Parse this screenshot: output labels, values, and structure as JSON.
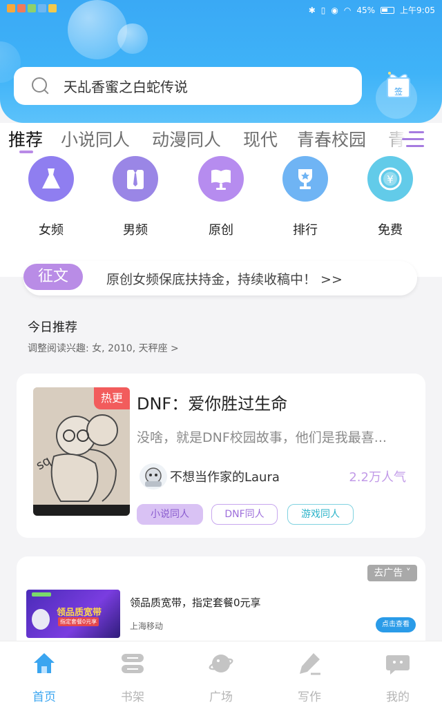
{
  "status_bar": {
    "battery": "45%",
    "time": "上午9:05"
  },
  "search": {
    "query": "天乩香蜜之白蛇传说"
  },
  "signin": {
    "label": "签"
  },
  "tabs": [
    "推荐",
    "小说同人",
    "动漫同人",
    "现代",
    "青春校园",
    "青春"
  ],
  "active_tab": 0,
  "quick_entries": [
    {
      "label": "女频",
      "icon": "dress-icon",
      "color": "#8f7ef0"
    },
    {
      "label": "男频",
      "icon": "shirt-icon",
      "color": "#9a86e6"
    },
    {
      "label": "原创",
      "icon": "book-stand-icon",
      "color": "#b68cef"
    },
    {
      "label": "排行",
      "icon": "trophy-icon",
      "color": "#6fb4f4"
    },
    {
      "label": "免费",
      "icon": "coin-icon",
      "color": "#62cbe9"
    }
  ],
  "notice": {
    "badge": "征文",
    "text": "原创女频保底扶持金，持续收稿中！ >>"
  },
  "recommend": {
    "title": "今日推荐",
    "subtitle": "调整阅读兴趣: 女, 2010, 天秤座 >"
  },
  "book": {
    "badge": "热更",
    "title": "DNF：爱你胜过生命",
    "description": "没啥，就是DNF校园故事，他们是我最喜...",
    "author": "不想当作家的Laura",
    "popularity": "2.2万人气",
    "tags": [
      {
        "label": "小说同人",
        "style": "filled"
      },
      {
        "label": "DNF同人",
        "style": "outline-purple"
      },
      {
        "label": "游戏同人",
        "style": "outline-teal"
      }
    ]
  },
  "ad": {
    "close_label": "去广告 ˅",
    "image_text": "领品质宽带",
    "image_subtext": "指定套餐0元享",
    "title": "领品质宽带，指定套餐0元享",
    "source": "上海移动",
    "button": "点击查看"
  },
  "bottom_nav": [
    {
      "label": "首页",
      "icon": "home-icon",
      "active": true
    },
    {
      "label": "书架",
      "icon": "bookshelf-icon",
      "active": false
    },
    {
      "label": "广场",
      "icon": "planet-icon",
      "active": false
    },
    {
      "label": "写作",
      "icon": "pen-icon",
      "active": false
    },
    {
      "label": "我的",
      "icon": "chat-face-icon",
      "active": false
    }
  ],
  "colors": {
    "primary": "#3aa9f5",
    "accent_purple": "#b98ce6",
    "hot_red": "#f25c5c"
  }
}
